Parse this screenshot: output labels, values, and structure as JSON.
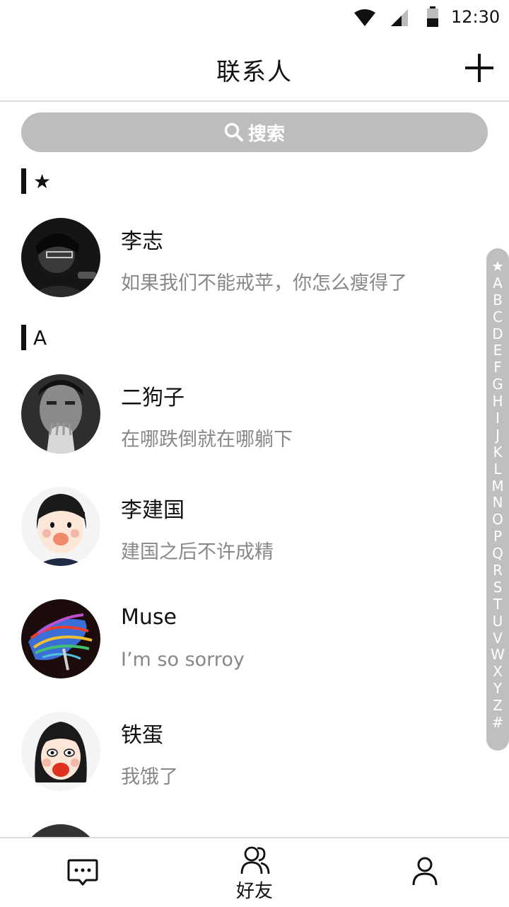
{
  "status_bar": {
    "time": "12:30"
  },
  "header": {
    "title": "联系人",
    "add_icon": "plus-icon"
  },
  "search": {
    "placeholder": "搜索",
    "icon": "search-icon"
  },
  "sections": [
    {
      "letter": "★",
      "contacts": [
        {
          "name": "李志",
          "signature": "如果我们不能戒苹，你怎么瘦得了",
          "avatar": "avatar-photo"
        }
      ]
    },
    {
      "letter": "A",
      "contacts": [
        {
          "name": "二狗子",
          "signature": "在哪跌倒就在哪躺下",
          "avatar": "avatar-photo"
        },
        {
          "name": "李建国",
          "signature": "建国之后不许成精",
          "avatar": "avatar-cartoon"
        },
        {
          "name": "Muse",
          "signature": "I’m so sorroy",
          "avatar": "avatar-album-art"
        },
        {
          "name": "铁蛋",
          "signature": "我饿了",
          "avatar": "avatar-cartoon"
        }
      ]
    }
  ],
  "index_letters": [
    "★",
    "A",
    "B",
    "C",
    "D",
    "E",
    "F",
    "G",
    "H",
    "I",
    "J",
    "K",
    "L",
    "M",
    "N",
    "O",
    "P",
    "Q",
    "R",
    "S",
    "T",
    "U",
    "V",
    "W",
    "X",
    "Y",
    "Z",
    "#"
  ],
  "tabs": [
    {
      "name": "messages",
      "icon": "chat-icon",
      "label": ""
    },
    {
      "name": "friends",
      "icon": "friends-icon",
      "label": "好友"
    },
    {
      "name": "profile",
      "icon": "user-icon",
      "label": ""
    }
  ],
  "colors": {
    "accent": "#111111",
    "search_bg": "#bdbdbd",
    "index_bg": "#bfbfbf",
    "muted_text": "#888888"
  }
}
